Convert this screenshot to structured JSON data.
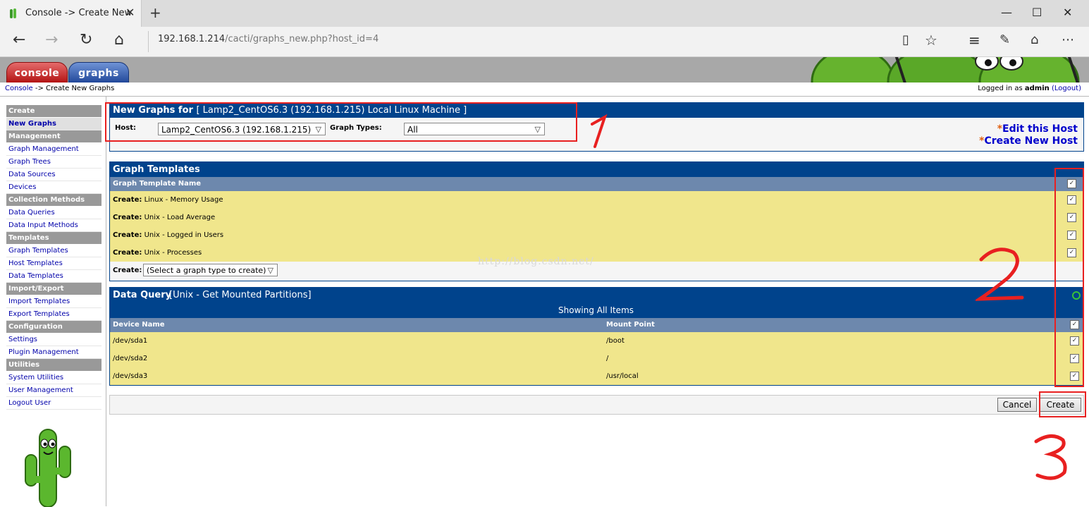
{
  "browser": {
    "tab_title": "Console -> Create New",
    "url_host": "192.168.1.214",
    "url_path": "/cacti/graphs_new.php?host_id=4"
  },
  "header": {
    "console_tab": "console",
    "graphs_tab": "graphs",
    "crumb_console": "Console",
    "crumb_rest": " -> Create New Graphs",
    "logged_in_prefix": "Logged in as ",
    "user": "admin",
    "logout": "(Logout)"
  },
  "sidebar": {
    "sections": [
      {
        "title": "Create",
        "items": [
          "New Graphs"
        ]
      },
      {
        "title": "Management",
        "items": [
          "Graph Management",
          "Graph Trees",
          "Data Sources",
          "Devices"
        ]
      },
      {
        "title": "Collection Methods",
        "items": [
          "Data Queries",
          "Data Input Methods"
        ]
      },
      {
        "title": "Templates",
        "items": [
          "Graph Templates",
          "Host Templates",
          "Data Templates"
        ]
      },
      {
        "title": "Import/Export",
        "items": [
          "Import Templates",
          "Export Templates"
        ]
      },
      {
        "title": "Configuration",
        "items": [
          "Settings",
          "Plugin Management"
        ]
      },
      {
        "title": "Utilities",
        "items": [
          "System Utilities",
          "User Management",
          "Logout User"
        ]
      }
    ]
  },
  "new_graphs": {
    "title": "New Graphs for",
    "host_name": "[ Lamp2_CentOS6.3 (192.168.1.215) Local Linux Machine ]",
    "host_label": "Host:",
    "host_value": "Lamp2_CentOS6.3 (192.168.1.215)",
    "types_label": "Graph Types:",
    "types_value": "All",
    "edit_host": "Edit this Host",
    "create_host": "Create New Host",
    "asterisk": "*"
  },
  "graph_templates": {
    "title": "Graph Templates",
    "column": "Graph Template Name",
    "create_prefix": "Create:",
    "rows": [
      "Linux - Memory Usage",
      "Unix - Load Average",
      "Unix - Logged in Users",
      "Unix - Processes"
    ],
    "select_label": "Create:",
    "select_value": "(Select a graph type to create)",
    "watermark": "http://blog.csdn.net/"
  },
  "data_query": {
    "title": "Data Query",
    "name": "[Unix - Get Mounted Partitions]",
    "showing": "Showing All Items",
    "columns": [
      "Device Name",
      "Mount Point"
    ],
    "rows": [
      {
        "device": "/dev/sda1",
        "mount": "/boot"
      },
      {
        "device": "/dev/sda2",
        "mount": "/"
      },
      {
        "device": "/dev/sda3",
        "mount": "/usr/local"
      }
    ]
  },
  "actions": {
    "cancel": "Cancel",
    "create": "Create"
  },
  "annotations": [
    "1",
    "2",
    "3"
  ],
  "colors": {
    "panel_header": "#00438c",
    "column_header": "#6d88ad",
    "row_bg": "#f0e68c",
    "annotation": "#e82020"
  }
}
